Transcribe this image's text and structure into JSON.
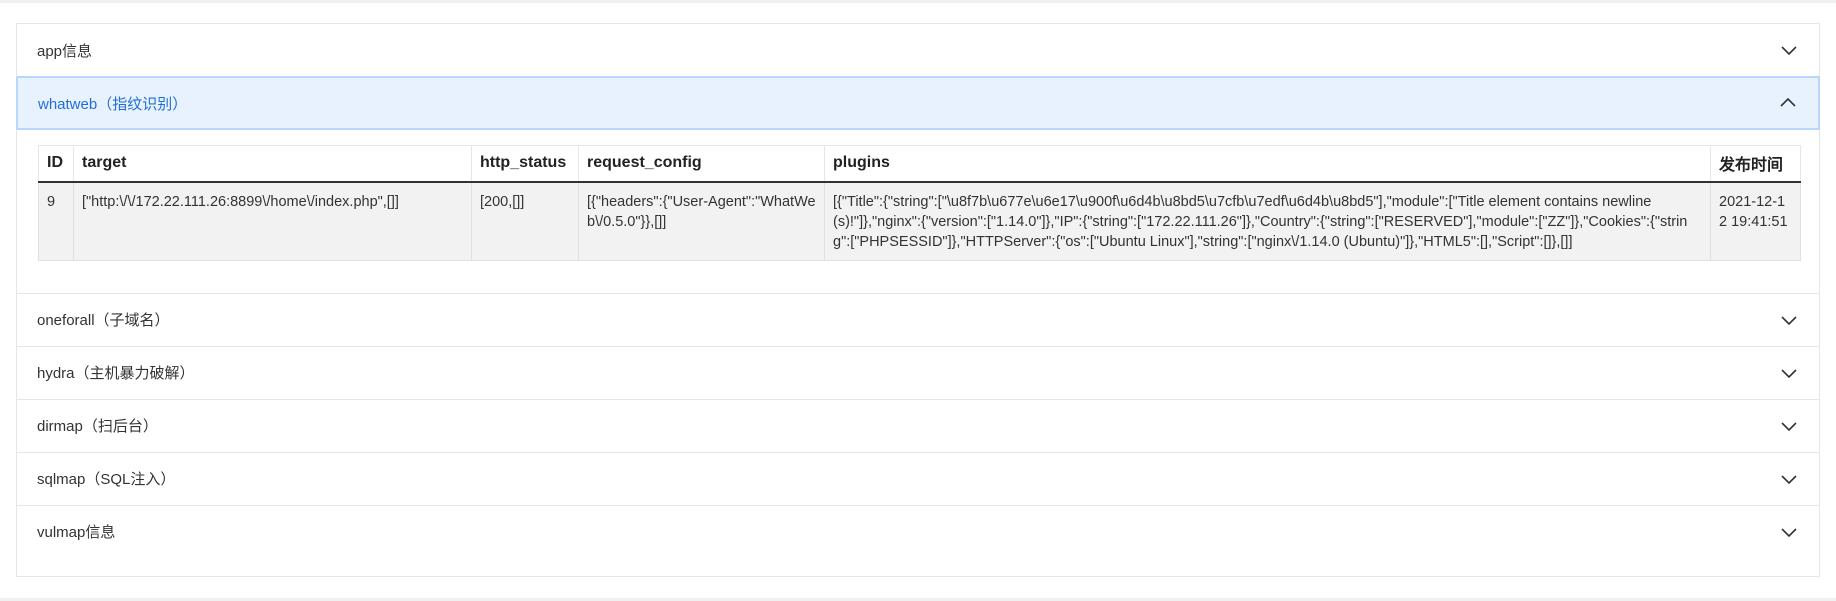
{
  "sections": [
    {
      "title": "app信息",
      "expanded": false
    },
    {
      "title": "whatweb（指纹识别）",
      "expanded": true
    },
    {
      "title": "oneforall（子域名）",
      "expanded": false
    },
    {
      "title": "hydra（主机暴力破解）",
      "expanded": false
    },
    {
      "title": "dirmap（扫后台）",
      "expanded": false
    },
    {
      "title": "sqlmap（SQL注入）",
      "expanded": false
    },
    {
      "title": "vulmap信息",
      "expanded": false
    }
  ],
  "whatweb_table": {
    "headers": [
      "ID",
      "target",
      "http_status",
      "request_config",
      "plugins",
      "发布时间"
    ],
    "rows": [
      [
        "9",
        "[\"http:\\/\\/172.22.111.26:8899\\/home\\/index.php\",[]]",
        "[200,[]]",
        "[{\"headers\":{\"User-Agent\":\"WhatWeb\\/0.5.0\"}},[]]",
        "[{\"Title\":{\"string\":[\"\\u8f7b\\u677e\\u6e17\\u900f\\u6d4b\\u8bd5\\u7cfb\\u7edf\\u6d4b\\u8bd5\"],\"module\":[\"Title element contains newline(s)!\"]},\"nginx\":{\"version\":[\"1.14.0\"]},\"IP\":{\"string\":[\"172.22.111.26\"]},\"Country\":{\"string\":[\"RESERVED\"],\"module\":[\"ZZ\"]},\"Cookies\":{\"string\":[\"PHPSESSID\"]},\"HTTPServer\":{\"os\":[\"Ubuntu Linux\"],\"string\":[\"nginx\\/1.14.0 (Ubuntu)\"]},\"HTML5\":[],\"Script\":[]},[]]",
        "2021-12-12 19:41:51"
      ]
    ]
  },
  "icons": {
    "collapsed": "chevron-down-icon",
    "expanded": "chevron-up-icon"
  },
  "colors": {
    "active_text": "#1f6fd6",
    "active_bg": "#e8f1fe",
    "active_border": "#b9d6fb"
  }
}
